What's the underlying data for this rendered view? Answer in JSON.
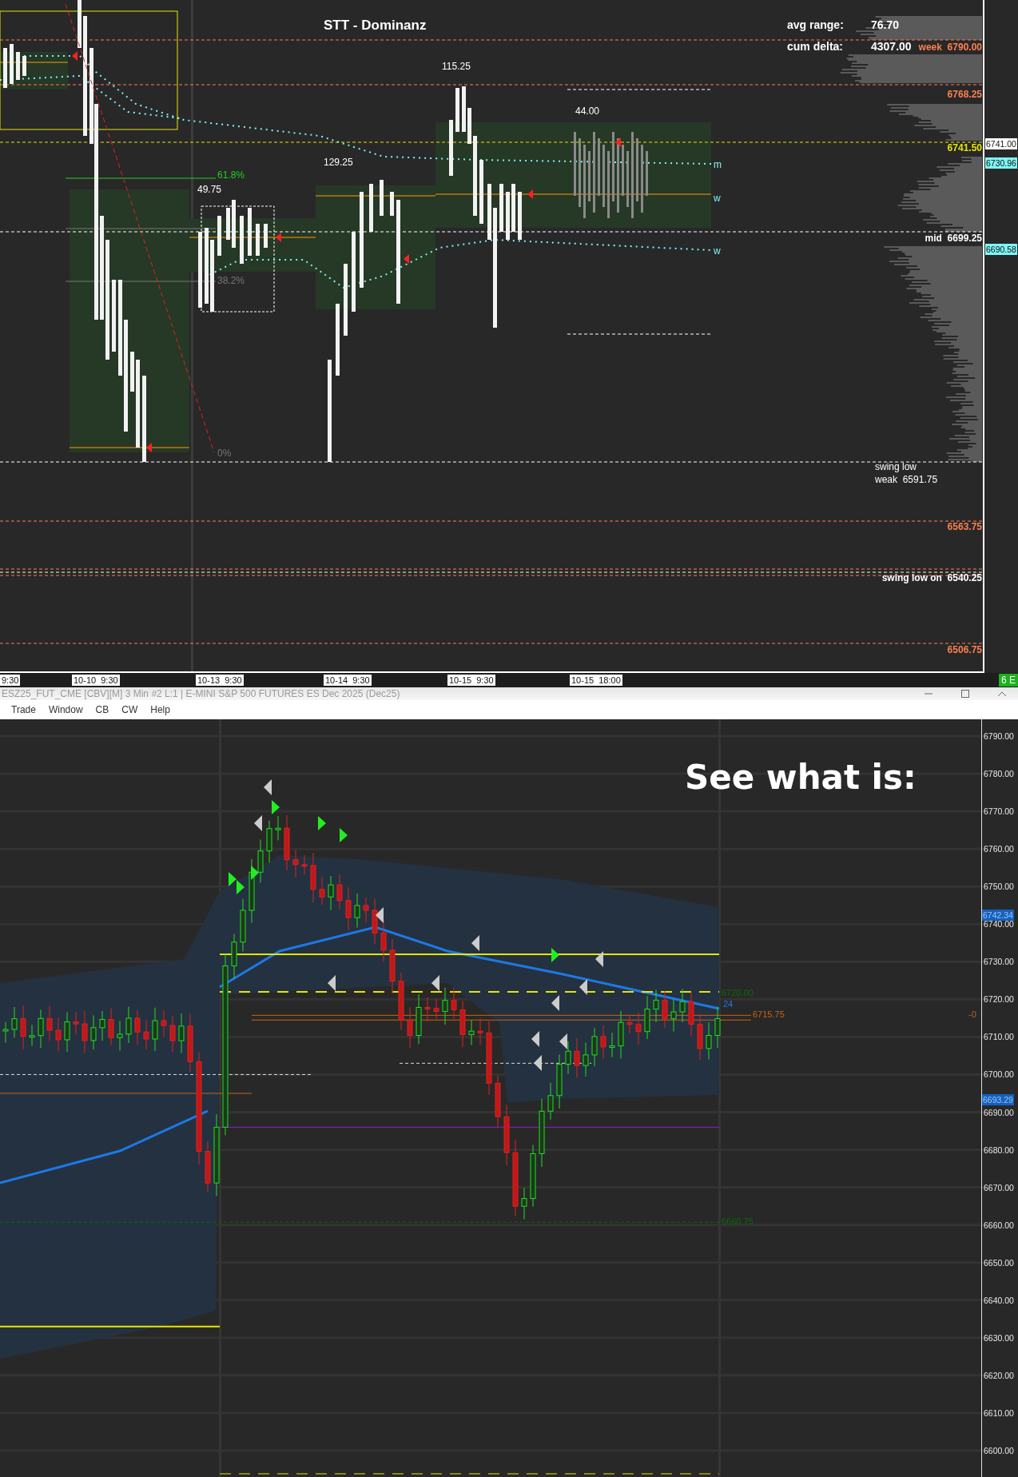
{
  "top_chart": {
    "title": "STT - Dominanz",
    "stats": [
      {
        "label": "avg range:",
        "value": "76.70"
      },
      {
        "label": "cum delta:",
        "value": "4307.00"
      }
    ],
    "level_labels": [
      {
        "tag": "week",
        "price": "6790.00",
        "color": "#ff7f50"
      },
      {
        "price": "6768.25",
        "color": "#ff7f50"
      },
      {
        "price": "6741.50",
        "color": "#e6e600"
      },
      {
        "tag": "mid",
        "price": "6699.25",
        "color": "#ffffff"
      },
      {
        "price": "6563.75",
        "color": "#ff7f50"
      },
      {
        "tag": "swing low on",
        "price": "6540.25",
        "color": "#ffffff"
      },
      {
        "price": "6506.75",
        "color": "#ff7f50"
      }
    ],
    "swing_note": [
      "swing low",
      "weak  6591.75"
    ],
    "range_labels": [
      "115.25",
      "44.00",
      "129.25",
      "49.75"
    ],
    "fib_labels": [
      {
        "text": "61.8%",
        "color": "#22cc22"
      },
      {
        "text": "38.2%",
        "color": "#777777"
      },
      {
        "text": "0%",
        "color": "#777777"
      }
    ],
    "line_tags": [
      "m",
      "w",
      "w"
    ],
    "axis_prices": [
      {
        "text": "6741.00",
        "color": "#ffffff"
      },
      {
        "text": "6730.96",
        "color": "#7ff5f5"
      },
      {
        "text": "6690.58",
        "color": "#7ff5f5"
      }
    ],
    "time_labels": [
      "9:30",
      "10-10  9:30",
      "10-13  9:30",
      "10-14  9:30",
      "10-15  9:30",
      "10-15  18:00"
    ],
    "badge": "6 E"
  },
  "window": {
    "title": "ESZ25_FUT_CME [CBV][M]  3 Min  #2 L:1 | E-MINI S&P 500 FUTURES ES Dec 2025 (Dec25)",
    "menu": [
      "Trade",
      "Window",
      "CB",
      "CW",
      "Help"
    ]
  },
  "bottom_chart": {
    "headline": "See what is:",
    "price_ticks": [
      "6790.00",
      "6780.00",
      "6770.00",
      "6760.00",
      "6750.00",
      "6740.00",
      "6730.00",
      "6720.00",
      "6710.00",
      "6700.00",
      "6690.00",
      "6680.00",
      "6670.00",
      "6660.00",
      "6650.00",
      "6640.00",
      "6630.00",
      "6620.00",
      "6610.00",
      "6600.00"
    ],
    "axis_markers": [
      "6742.34",
      "6693.29"
    ],
    "line_labels": [
      {
        "text": "6720.00",
        "color": "#0c6a0c"
      },
      {
        "text": "24",
        "color": "#1e78e6"
      },
      {
        "text": "6715.75",
        "color": "#c86414"
      },
      {
        "text": "6660.75",
        "color": "#0c6a0c"
      }
    ],
    "right_marker": "-0"
  }
}
